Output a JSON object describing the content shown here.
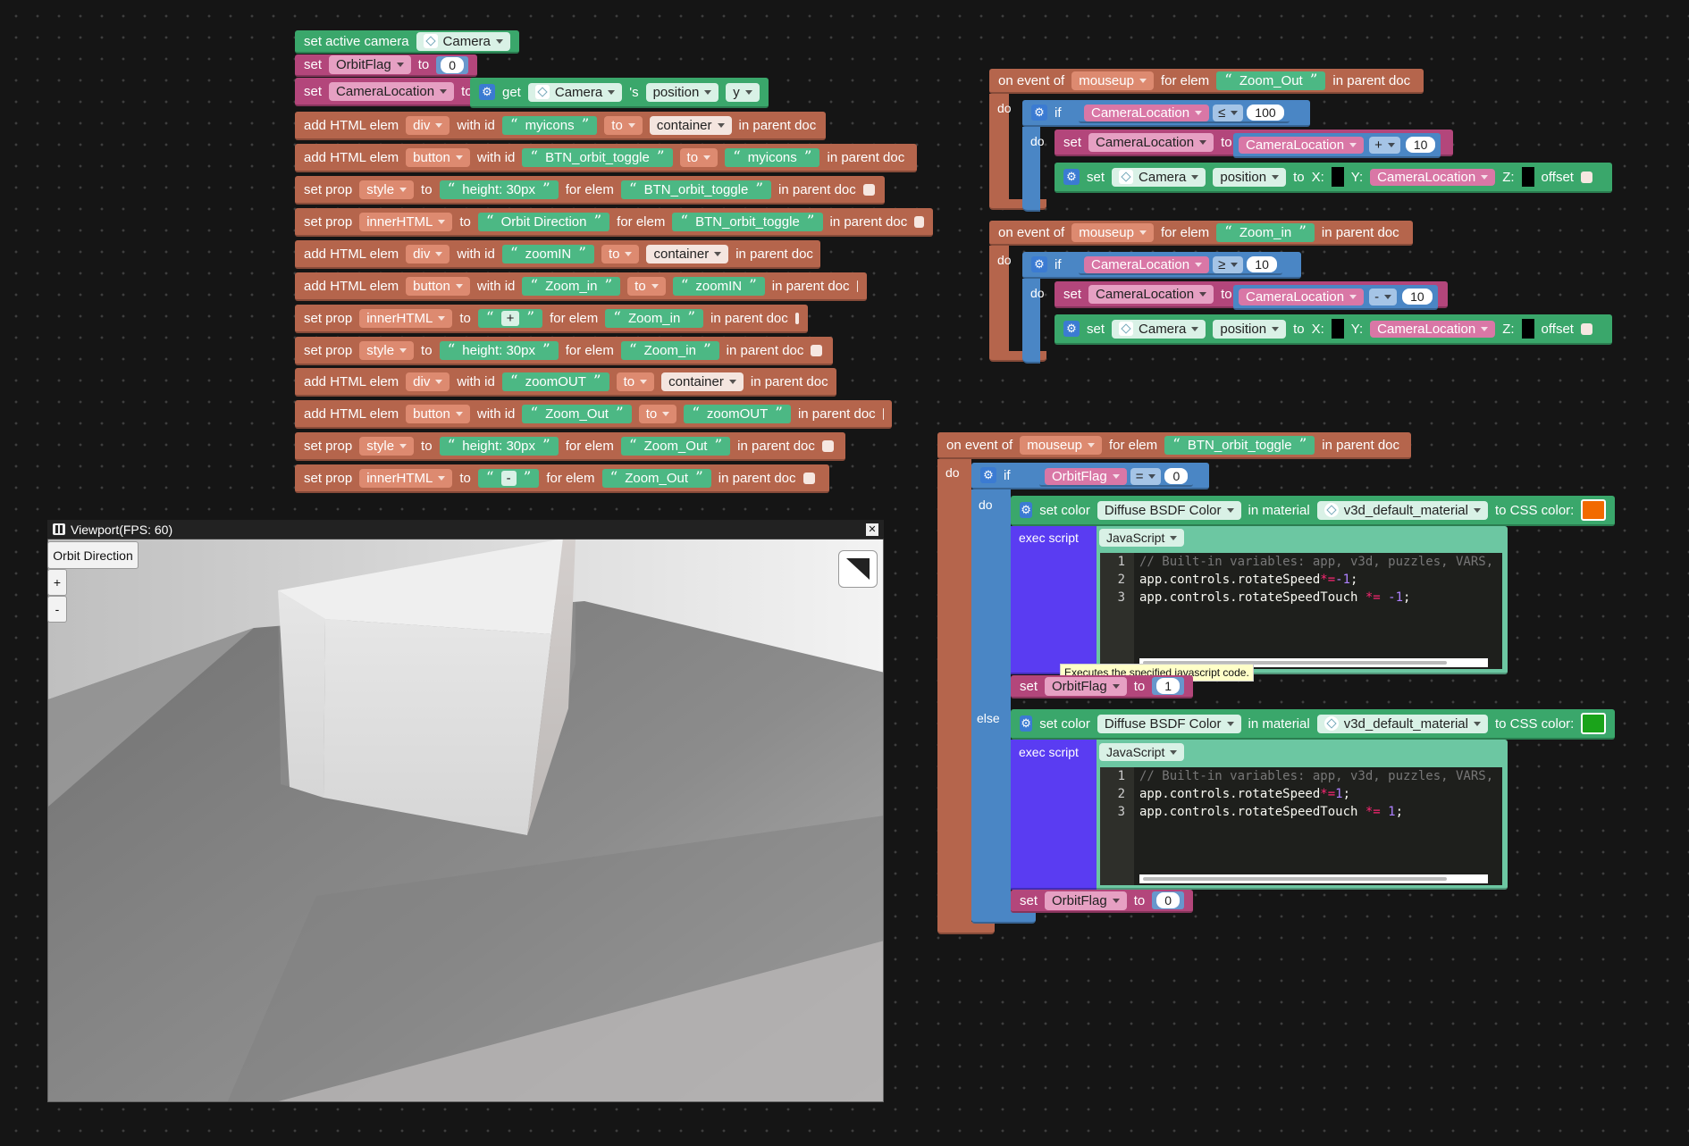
{
  "common": {
    "to": "to",
    "set": "set",
    "get": "get",
    "in_parent_doc": "in parent doc",
    "for_elem": "for elem",
    "with_id": "with id",
    "do": "do",
    "if": "if",
    "else": "else",
    "on_event_of": "on event of",
    "open_q": "“",
    "close_q": "”",
    "add_html_elem": "add HTML elem",
    "set_prop": "set prop",
    "s_suffix": "'s",
    "x_label": "X:",
    "y_label": "Y:",
    "z_label": "Z:",
    "offset": "offset",
    "exec_script": "exec script",
    "set_color": "set color",
    "in_material": "in material",
    "to_css_color": "to CSS color:",
    "set_active_camera": "set active camera"
  },
  "left": {
    "camera": "Camera",
    "orbit_flag": "OrbitFlag",
    "zero": "0",
    "camera_location": "CameraLocation",
    "position": "position",
    "y": "y",
    "rows": [
      {
        "kind": "add",
        "tag": "div",
        "id": "myicons",
        "target": "container",
        "target_style": "bw"
      },
      {
        "kind": "add",
        "tag": "button",
        "id": "BTN_orbit_toggle",
        "target": "myicons",
        "target_style": "pill"
      },
      {
        "kind": "prop",
        "prop": "style",
        "value": "height: 30px",
        "elem": "BTN_orbit_toggle"
      },
      {
        "kind": "prop",
        "prop": "innerHTML",
        "value": "Orbit Direction",
        "elem": "BTN_orbit_toggle"
      },
      {
        "kind": "add",
        "tag": "div",
        "id": "zoomIN",
        "target": "container",
        "target_style": "bw"
      },
      {
        "kind": "add",
        "tag": "button",
        "id": "Zoom_in",
        "target": "zoomIN",
        "target_style": "pill"
      },
      {
        "kind": "prop",
        "prop": "innerHTML",
        "value": "+",
        "elem": "Zoom_in"
      },
      {
        "kind": "prop",
        "prop": "style",
        "value": "height: 30px",
        "elem": "Zoom_in"
      },
      {
        "kind": "add",
        "tag": "div",
        "id": "zoomOUT",
        "target": "container",
        "target_style": "bw"
      },
      {
        "kind": "add",
        "tag": "button",
        "id": "Zoom_Out",
        "target": "zoomOUT",
        "target_style": "pill"
      },
      {
        "kind": "prop",
        "prop": "style",
        "value": "height: 30px",
        "elem": "Zoom_Out"
      },
      {
        "kind": "prop",
        "prop": "innerHTML",
        "value": "-",
        "elem": "Zoom_Out"
      }
    ]
  },
  "ev1": {
    "event": "mouseup",
    "elem": "Zoom_Out",
    "var": "CameraLocation",
    "op": "≤",
    "limit": "100",
    "op2": "+",
    "step": "10",
    "camera": "Camera",
    "position": "position"
  },
  "ev2": {
    "event": "mouseup",
    "elem": "Zoom_in",
    "var": "CameraLocation",
    "op": "≥",
    "limit": "10",
    "op2": "-",
    "step": "10",
    "camera": "Camera",
    "position": "position"
  },
  "ev3": {
    "event": "mouseup",
    "elem": "BTN_orbit_toggle",
    "flag": "OrbitFlag",
    "op": "=",
    "val": "0",
    "color_param": "Diffuse BSDF Color",
    "material": "v3d_default_material",
    "lang": "JavaScript",
    "color_do": "#f26a00",
    "color_else": "#1aa31a",
    "set_do": "1",
    "set_else": "0",
    "tooltip": "Executes the specified javascript code.",
    "code_do": {
      "l1": "// Built-in variables: app, v3d, puzzles, VARS,",
      "l2a": "app.controls.rotateSpeed",
      "l2op": "*=",
      "l2n": "-1",
      "l2e": ";",
      "l3a": "app.controls.rotateSpeedTouch ",
      "l3op": "*=",
      "l3n": " -1",
      "l3e": ";"
    },
    "code_else": {
      "l1": "// Built-in variables: app, v3d, puzzles, VARS,",
      "l2a": "app.controls.rotateSpeed",
      "l2op": "*=",
      "l2n": "1",
      "l2e": ";",
      "l3a": "app.controls.rotateSpeedTouch ",
      "l3op": "*=",
      "l3n": " 1",
      "l3e": ";"
    },
    "line_nums": [
      "1",
      "2",
      "3"
    ]
  },
  "viewport": {
    "title": "Viewport(FPS: 60)",
    "close": "✕",
    "orbit_btn": "Orbit Direction",
    "plus": "+",
    "minus": "-"
  }
}
